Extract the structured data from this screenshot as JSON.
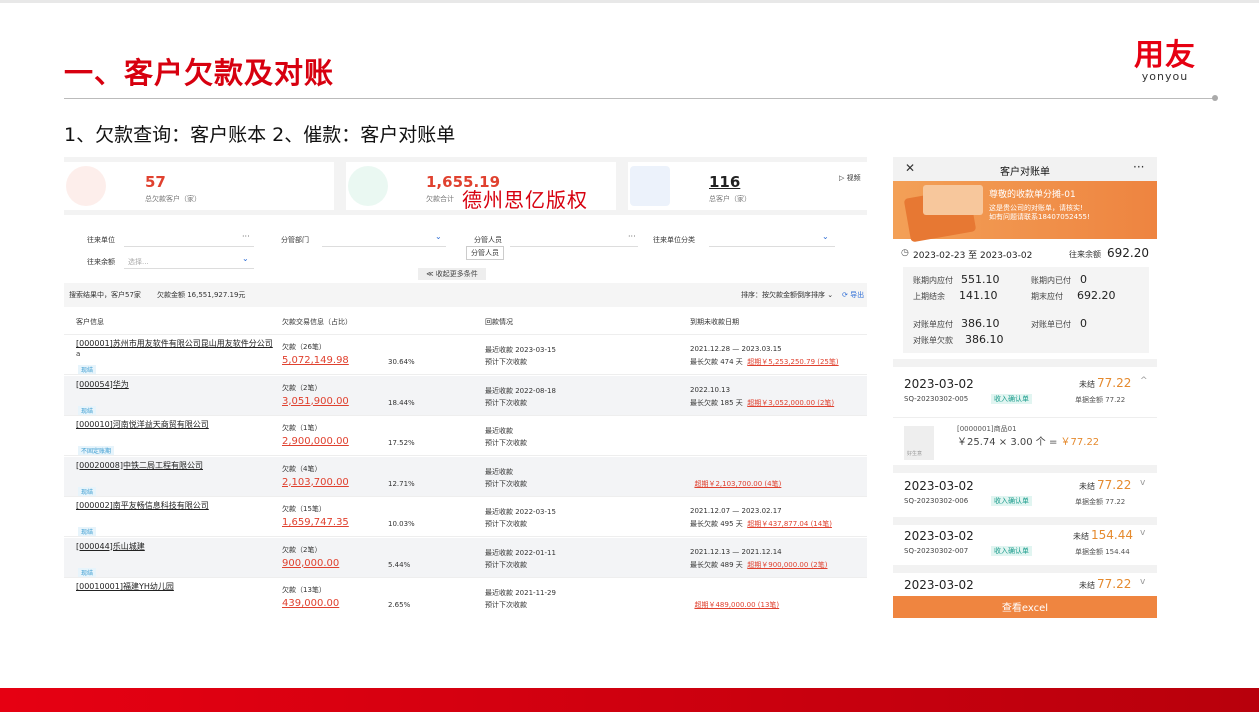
{
  "slide": {
    "title": "一、客户欠款及对账",
    "subtitle": "1、欠款查询：客户账本  2、催款：客户对账单",
    "logo_cn": "用友",
    "logo_en": "yonyou",
    "watermark": "德州思亿版权",
    "accent": "#d7000f"
  },
  "desktop": {
    "stats": [
      {
        "value": "57",
        "label": "总欠款客户（家）"
      },
      {
        "value": "1,655.19",
        "label": "欠款合计"
      },
      {
        "value": "116",
        "label": "总客户（家）"
      }
    ],
    "video_label": "视频",
    "filters": {
      "contact_unit": "往来单位",
      "dept": "分管部门",
      "staff": "分管人员",
      "category": "往来单位分类",
      "balance": "往来余额",
      "balance_placeholder": "选择...",
      "tooltip": "分管人员",
      "more": "收起更多条件"
    },
    "summary": {
      "result": "搜索结果中，客户57家",
      "amount": "欠款金额 16,551,927.19元",
      "sort": "排序：按欠款金额倒序排序",
      "export": "导出"
    },
    "columns": [
      "客户信息",
      "欠款交易信息（占比）",
      "回款情况",
      "到期未收款日期"
    ],
    "rows": [
      {
        "name": "[000001]苏州市用友软件有限公司昆山用友软件分公司",
        "name2": "a",
        "tag": "现结",
        "count": "欠款（26笔）",
        "amount": "5,072,149.98",
        "pct": "30.64%",
        "r1": "最近收款    2023-03-15",
        "r2": "预计下次收款",
        "d1": "2021.12.28 — 2023.03.15",
        "d2a": "最长欠款 474 天",
        "d2b": "超期￥5,253,250.79 (25笔)"
      },
      {
        "name": "[000054]华为",
        "name2": "",
        "tag": "现结",
        "count": "欠款（2笔）",
        "amount": "3,051,900.00",
        "pct": "18.44%",
        "r1": "最近收款    2022-08-18",
        "r2": "预计下次收款",
        "d1": "2022.10.13",
        "d2a": "最长欠款 185 天",
        "d2b": "超期￥3,052,000.00 (2笔)"
      },
      {
        "name": "[000010]河南悦洋益天商贸有限公司",
        "name2": "",
        "tag": "不固定账期",
        "count": "欠款（1笔）",
        "amount": "2,900,000.00",
        "pct": "17.52%",
        "r1": "最近收款",
        "r2": "预计下次收款",
        "d1": "",
        "d2a": "",
        "d2b": ""
      },
      {
        "name": "[00020008]中铁二局工程有限公司",
        "name2": "",
        "tag": "现结",
        "count": "欠款（4笔）",
        "amount": "2,103,700.00",
        "pct": "12.71%",
        "r1": "最近收款",
        "r2": "预计下次收款",
        "d1": "",
        "d2a": "",
        "d2b": "超期￥2,103,700.00 (4笔)"
      },
      {
        "name": "[000002]南平友畅信息科技有限公司",
        "name2": "",
        "tag": "现结",
        "count": "欠款（15笔）",
        "amount": "1,659,747.35",
        "pct": "10.03%",
        "r1": "最近收款    2022-03-15",
        "r2": "预计下次收款",
        "d1": "2021.12.07 — 2023.02.17",
        "d2a": "最长欠款 495 天",
        "d2b": "超期￥437,877.04 (14笔)"
      },
      {
        "name": "[000044]乐山城建",
        "name2": "",
        "tag": "现结",
        "count": "欠款（2笔）",
        "amount": "900,000.00",
        "pct": "5.44%",
        "r1": "最近收款    2022-01-11",
        "r2": "预计下次收款",
        "d1": "2021.12.13 — 2021.12.14",
        "d2a": "最长欠款 489 天",
        "d2b": "超期￥900,000.00 (2笔)"
      },
      {
        "name": "[00010001]福建YH幼儿园",
        "name2": "",
        "tag": "",
        "count": "欠款（13笔）",
        "amount": "439,000.00",
        "pct": "2.65%",
        "r1": "最近收款    2021-11-29",
        "r2": "预计下次收款",
        "d1": "",
        "d2a": "",
        "d2b": "超期￥489,000.00 (13笔)"
      }
    ]
  },
  "mobile": {
    "title": "客户对账单",
    "banner_title": "尊敬的收款单分摊-01",
    "banner_line1": "这是贵公司的对账单，请核实!",
    "banner_line2": "如有问题请联系18407052455!",
    "period": "2023-02-23  至  2023-03-02",
    "balance_label": "往来余额",
    "balance": "692.20",
    "summary": [
      {
        "k": "账期内应付",
        "v": "551.10"
      },
      {
        "k": "账期内已付",
        "v": "0"
      },
      {
        "k": "上期结余",
        "v": "141.10"
      },
      {
        "k": "期末应付",
        "v": "692.20"
      },
      {
        "k": "对账单应付",
        "v": "386.10"
      },
      {
        "k": "对账单已付",
        "v": "0"
      },
      {
        "k": "对账单欠款",
        "v": "386.10"
      }
    ],
    "entries": [
      {
        "date": "2023-03-02",
        "status": "未结",
        "amount": "77.22",
        "no": "SQ-20230302-005",
        "badge": "收入确认单",
        "sum": "单据金额 77.22",
        "chev": "^"
      },
      {
        "date": "2023-03-02",
        "status": "未结",
        "amount": "77.22",
        "no": "SQ-20230302-006",
        "badge": "收入确认单",
        "sum": "单据金额 77.22",
        "chev": "v"
      },
      {
        "date": "2023-03-02",
        "status": "未结",
        "amount": "154.44",
        "no": "SQ-20230302-007",
        "badge": "收入确认单",
        "sum": "单据金额 154.44",
        "chev": "v"
      },
      {
        "date": "2023-03-02",
        "status": "未结",
        "amount": "77.22",
        "no": "",
        "badge": "",
        "sum": "",
        "chev": "v"
      }
    ],
    "item": {
      "name": "[0000001]商品01",
      "formula": "￥25.74 × 3.00 个 = ",
      "total": "￥77.22",
      "pic_label": "好生意"
    },
    "excel": "查看excel"
  }
}
